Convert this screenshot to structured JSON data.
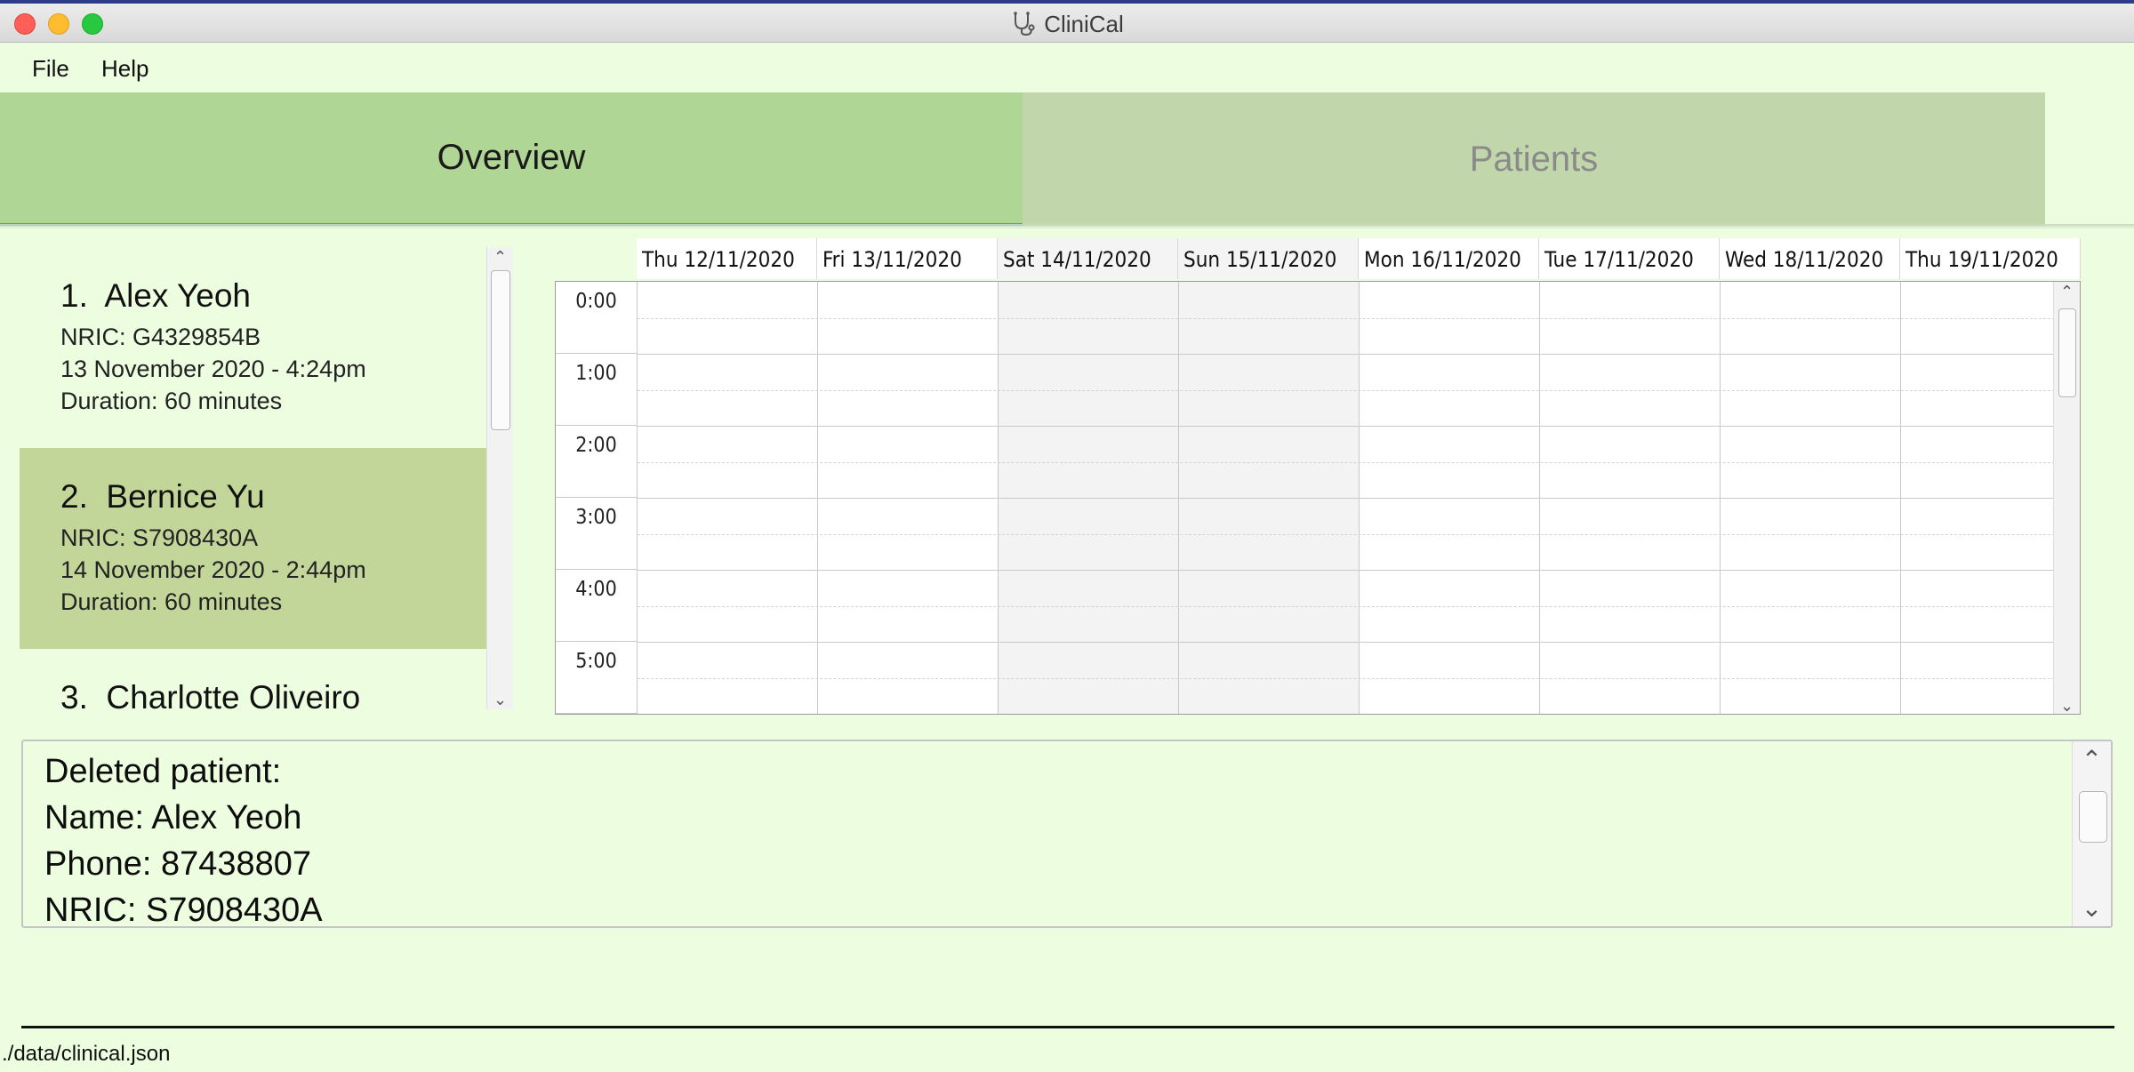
{
  "window": {
    "title": "CliniCal"
  },
  "menu": {
    "file": "File",
    "help": "Help"
  },
  "tabs": {
    "overview": "Overview",
    "patients": "Patients"
  },
  "appointments": [
    {
      "index": "1.",
      "name": "Alex Yeoh",
      "nric": "NRIC: G4329854B",
      "datetime": "13 November 2020 - 4:24pm",
      "duration": "Duration: 60 minutes",
      "selected": false
    },
    {
      "index": "2.",
      "name": "Bernice Yu",
      "nric": "NRIC: S7908430A",
      "datetime": "14 November 2020 - 2:44pm",
      "duration": "Duration: 60 minutes",
      "selected": true
    },
    {
      "index": "3.",
      "name": "Charlotte Oliveiro",
      "nric": "",
      "datetime": "",
      "duration": "",
      "selected": false
    }
  ],
  "calendar": {
    "days": [
      {
        "label": "Thu 12/11/2020",
        "weekend": false
      },
      {
        "label": "Fri 13/11/2020",
        "weekend": false
      },
      {
        "label": "Sat 14/11/2020",
        "weekend": true
      },
      {
        "label": "Sun 15/11/2020",
        "weekend": true
      },
      {
        "label": "Mon 16/11/2020",
        "weekend": false
      },
      {
        "label": "Tue 17/11/2020",
        "weekend": false
      },
      {
        "label": "Wed 18/11/2020",
        "weekend": false
      },
      {
        "label": "Thu 19/11/2020",
        "weekend": false
      }
    ],
    "hours": [
      "0:00",
      "1:00",
      "2:00",
      "3:00",
      "4:00",
      "5:00"
    ]
  },
  "result": {
    "lines": [
      "Deleted patient:",
      "Name: Alex Yeoh",
      "Phone: 87438807",
      "NRIC: S7908430A"
    ]
  },
  "status": {
    "path": "./data/clinical.json"
  },
  "colors": {
    "background": "#edfde0",
    "tab_active": "#b0d695",
    "tab_inactive": "#c1d6aa",
    "selected_card": "#c2d69a"
  },
  "icons": {
    "app": "stethoscope-icon",
    "scroll_up": "chevron-up-icon",
    "scroll_down": "chevron-down-icon"
  }
}
